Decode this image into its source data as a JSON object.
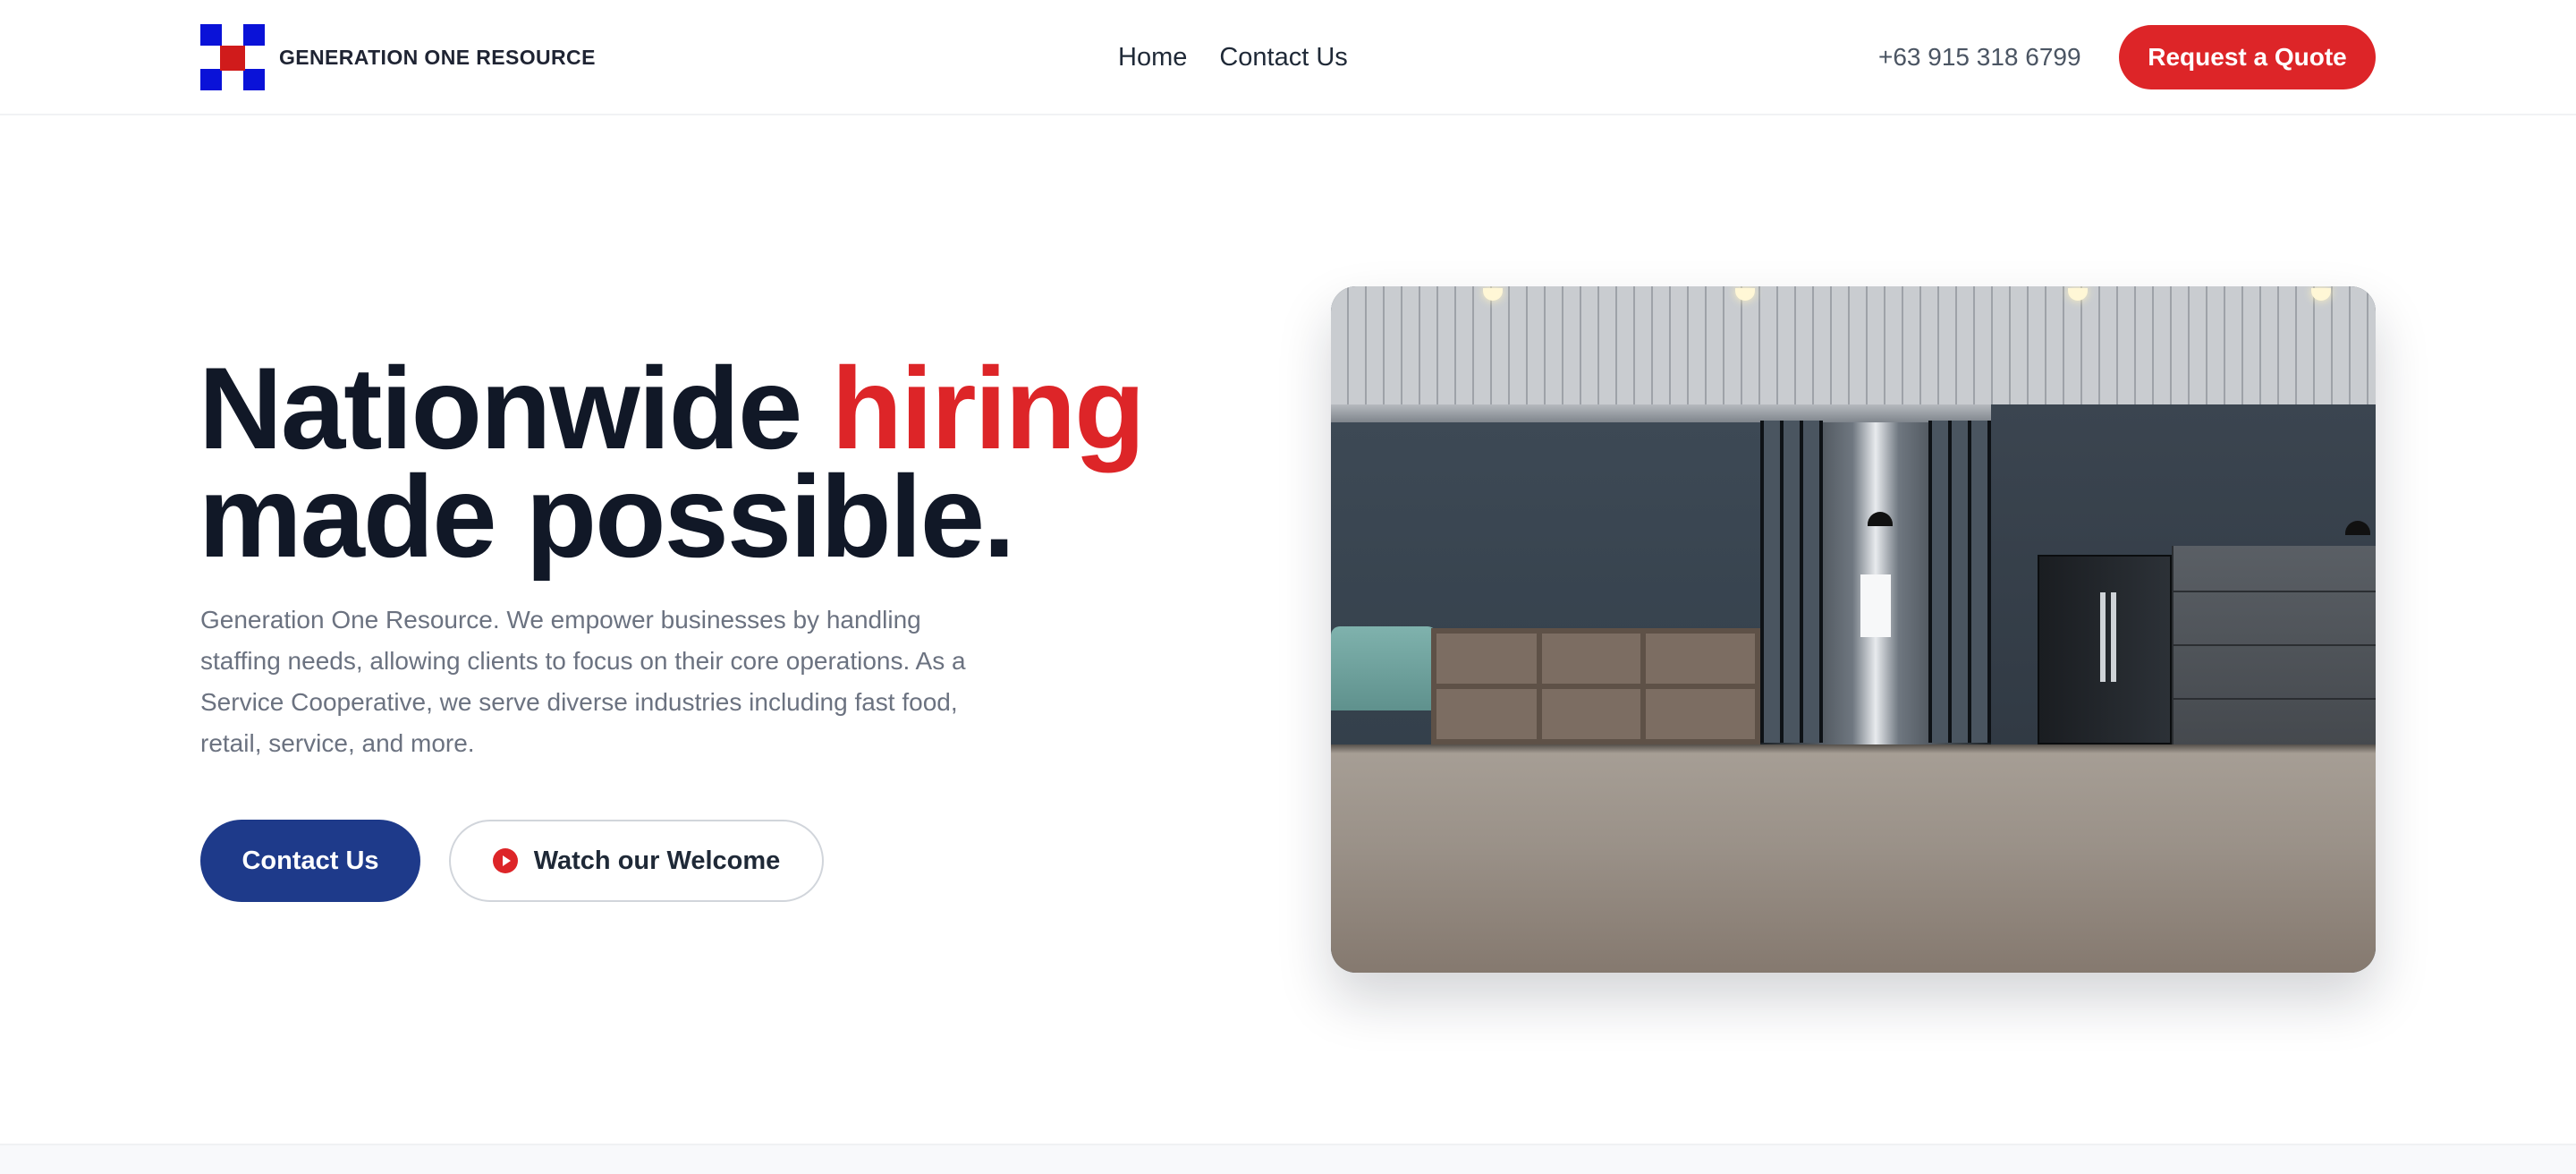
{
  "brand": {
    "name": "GENERATION ONE RESOURCE"
  },
  "nav": {
    "items": [
      {
        "label": "Home"
      },
      {
        "label": "Contact Us"
      }
    ]
  },
  "header": {
    "phone": "+63 915 318 6799",
    "cta_label": "Request a Quote"
  },
  "hero": {
    "headline_part1": "Nationwide ",
    "headline_accent": "hiring",
    "headline_part2": "made possible.",
    "description": "Generation One Resource. We empower businesses by handling staffing needs, allowing clients to focus on their core operations. As a Service Cooperative, we serve diverse industries including fast food, retail, service, and more.",
    "primary_button": "Contact Us",
    "secondary_button": "Watch our Welcome"
  },
  "colors": {
    "accent_red": "#dd2528",
    "primary_navy": "#1e3a8a",
    "logo_blue": "#0a12d8",
    "logo_red": "#d01b1b",
    "headline_dark": "#111827"
  },
  "icons": {
    "logo": "checker-logo-icon",
    "play": "play-circle-icon"
  }
}
